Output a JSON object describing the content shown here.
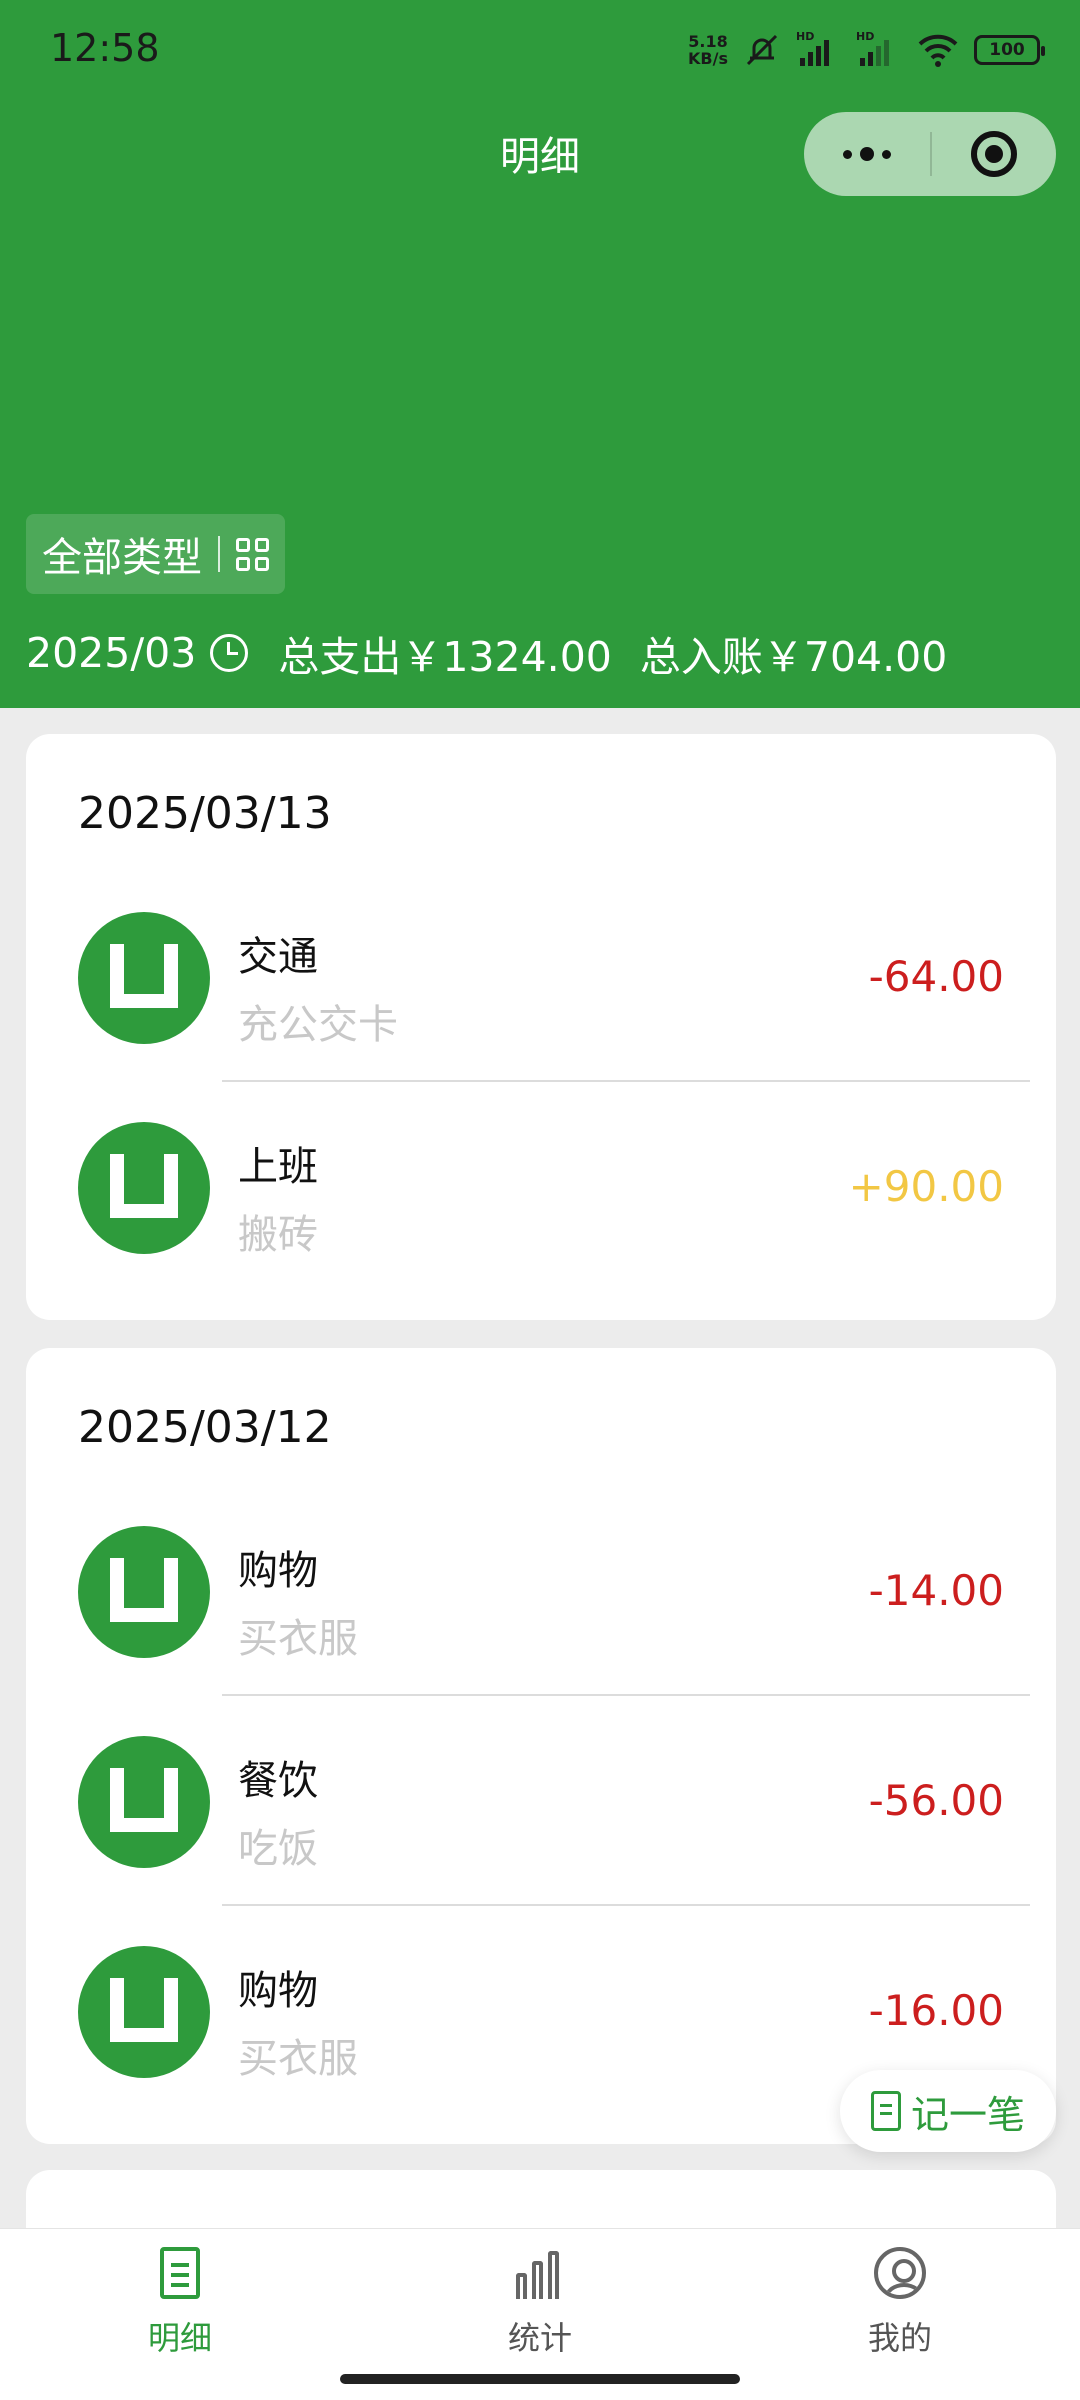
{
  "status_bar": {
    "time": "12:58",
    "net_speed_value": "5.18",
    "net_speed_unit": "KB/s",
    "signal_label": "HD",
    "battery": "100"
  },
  "header": {
    "title": "明细",
    "filter_label": "全部类型",
    "month": "2025/03",
    "total_expense": "总支出￥1324.00",
    "total_income": "总入账￥704.00"
  },
  "days": [
    {
      "date": "2025/03/13",
      "records": [
        {
          "category": "交通",
          "note": "充公交卡",
          "amount": "-64.00",
          "type": "expense"
        },
        {
          "category": "上班",
          "note": "搬砖",
          "amount": "+90.00",
          "type": "income"
        }
      ]
    },
    {
      "date": "2025/03/12",
      "records": [
        {
          "category": "购物",
          "note": "买衣服",
          "amount": "-14.00",
          "type": "expense"
        },
        {
          "category": "餐饮",
          "note": "吃饭",
          "amount": "-56.00",
          "type": "expense"
        },
        {
          "category": "购物",
          "note": "买衣服",
          "amount": "-16.00",
          "type": "expense"
        }
      ]
    }
  ],
  "fab_label": "记一笔",
  "tabbar": {
    "items": [
      {
        "label": "明细",
        "icon": "document-icon",
        "active": true
      },
      {
        "label": "统计",
        "icon": "bar-chart-icon",
        "active": false
      },
      {
        "label": "我的",
        "icon": "user-icon",
        "active": false
      }
    ]
  },
  "colors": {
    "brand_green": "#2e9b3c",
    "expense_red": "#cc1e1e",
    "income_yellow": "#f2c744",
    "inactive_gray": "#666666"
  }
}
